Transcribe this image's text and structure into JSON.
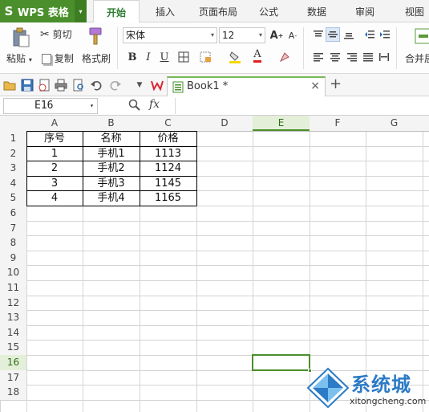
{
  "app": {
    "logo": "S",
    "name": "WPS 表格",
    "menu_caret": "▾"
  },
  "tabs": [
    "开始",
    "插入",
    "页面布局",
    "公式",
    "数据",
    "审阅",
    "视图"
  ],
  "active_tab": 0,
  "ribbon": {
    "paste": "粘贴",
    "cut": "剪切",
    "copy": "复制",
    "format_painter": "格式刷",
    "font_name": "宋体",
    "font_size": "12",
    "bold": "B",
    "italic": "I",
    "underline": "U",
    "merge": "合并居"
  },
  "document": {
    "name": "Book1 *",
    "close": "×",
    "new_tab": "+"
  },
  "formula_bar": {
    "cell_ref": "E16",
    "fx": "fx",
    "content": ""
  },
  "columns": [
    "A",
    "B",
    "C",
    "D",
    "E",
    "F",
    "G"
  ],
  "rows": [
    "1",
    "2",
    "3",
    "4",
    "5",
    "6",
    "7",
    "8",
    "9",
    "10",
    "11",
    "12",
    "13",
    "14",
    "15",
    "16",
    "17",
    "18"
  ],
  "selected": {
    "column": "E",
    "row": "16"
  },
  "table": {
    "headers": [
      "序号",
      "名称",
      "价格"
    ],
    "rows": [
      [
        "1",
        "手机1",
        "1113"
      ],
      [
        "2",
        "手机2",
        "1124"
      ],
      [
        "3",
        "手机3",
        "1145"
      ],
      [
        "4",
        "手机4",
        "1165"
      ]
    ]
  },
  "watermark": {
    "text": "系统城",
    "url": "xitongcheng.com"
  },
  "colors": {
    "accent": "#4a8f2c",
    "watermark_blue": "#2c7bc6",
    "font_color_red": "#e02020",
    "highlight_yellow": "#f5d800"
  }
}
